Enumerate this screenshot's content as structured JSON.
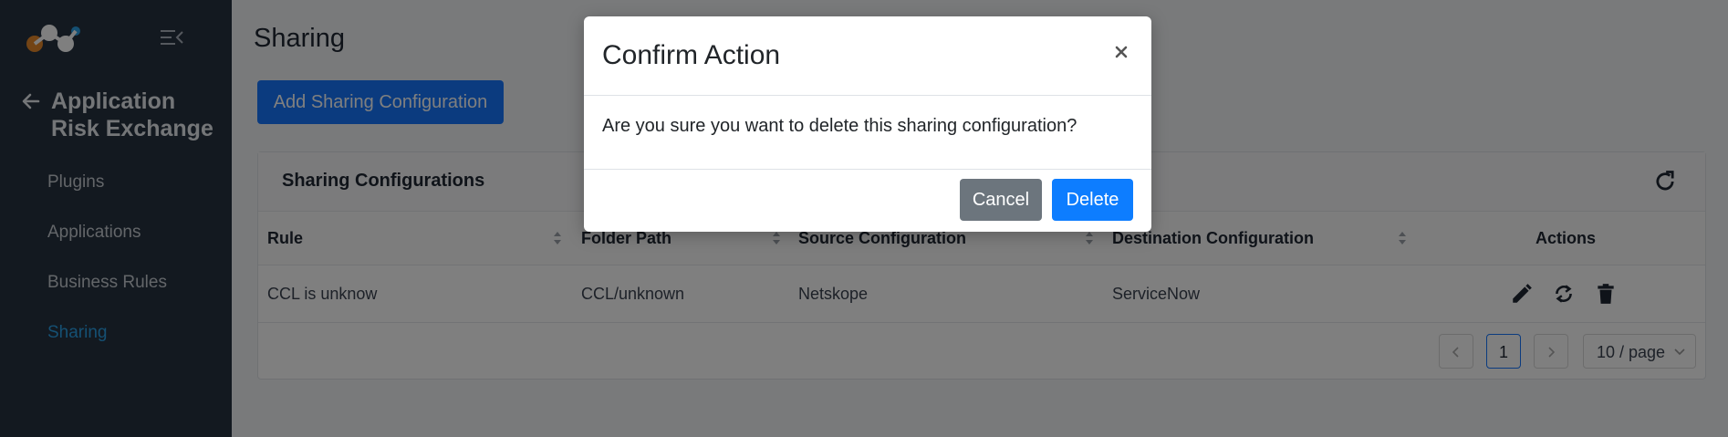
{
  "sidebar": {
    "back_title": "Application Risk Exchange",
    "items": [
      {
        "label": "Plugins",
        "active": false
      },
      {
        "label": "Applications",
        "active": false
      },
      {
        "label": "Business Rules",
        "active": false
      },
      {
        "label": "Sharing",
        "active": true
      }
    ]
  },
  "main": {
    "title": "Sharing",
    "add_button": "Add Sharing Configuration",
    "card_title": "Sharing Configurations",
    "columns": [
      "Rule",
      "Folder Path",
      "Source Configuration",
      "Destination Configuration",
      "Actions"
    ],
    "rows": [
      {
        "rule": "CCL is unknow",
        "folder_path": "CCL/unknown",
        "source": "Netskope",
        "destination": "ServiceNow"
      }
    ],
    "pagination": {
      "current_page": "1",
      "page_size": "10 / page"
    }
  },
  "modal": {
    "title": "Confirm Action",
    "message": "Are you sure you want to delete this sharing configuration?",
    "cancel_label": "Cancel",
    "delete_label": "Delete"
  },
  "colors": {
    "sidebar_bg": "#263241",
    "primary": "#1677ff",
    "active_nav": "#2aa0e6",
    "cancel": "#6c757d"
  },
  "icons": [
    "logo-icon",
    "collapse-menu-icon",
    "back-arrow-icon",
    "refresh-icon",
    "sort-icon",
    "edit-icon",
    "sync-icon",
    "delete-icon",
    "close-icon",
    "chevron-left-icon",
    "chevron-right-icon",
    "chevron-down-icon"
  ]
}
